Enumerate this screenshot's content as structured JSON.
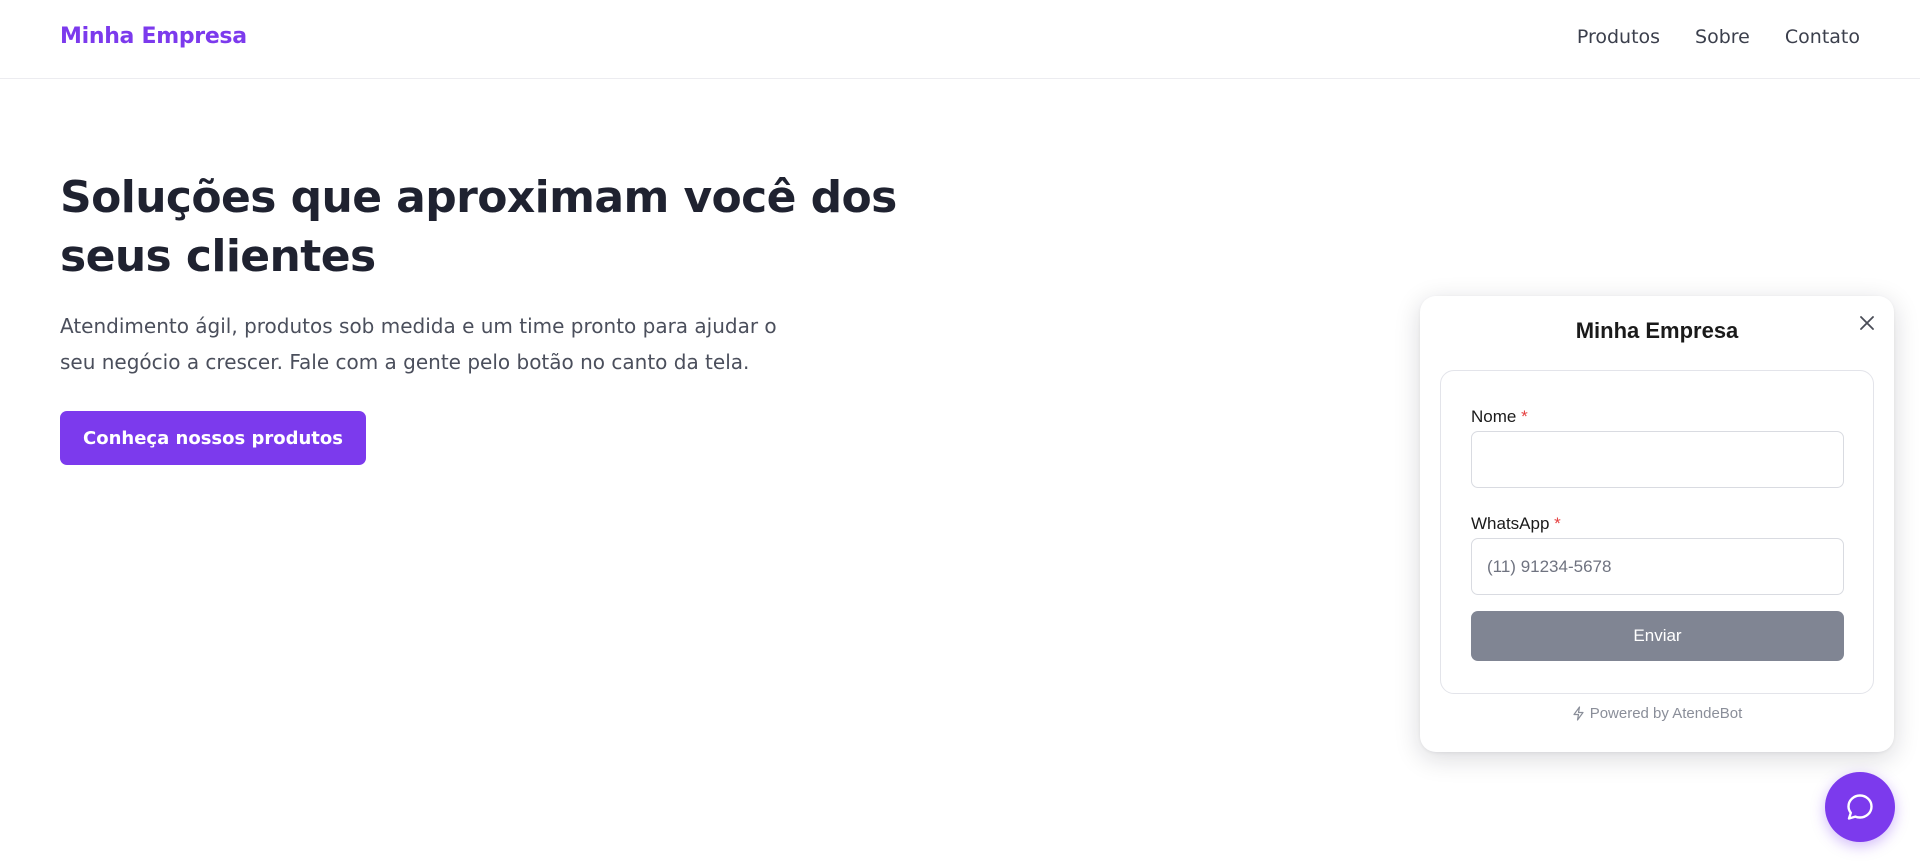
{
  "header": {
    "brand": "Minha Empresa",
    "nav": [
      "Produtos",
      "Sobre",
      "Contato"
    ]
  },
  "hero": {
    "title": "Soluções que aproximam você dos seus clientes",
    "subtitle": "Atendimento ágil, produtos sob medida e um time pronto para ajudar o seu negócio a crescer. Fale com a gente pelo botão no canto da tela.",
    "cta_label": "Conheça nossos produtos"
  },
  "widget": {
    "title": "Minha Empresa",
    "close_icon": "close-icon",
    "fields": {
      "name_label": "Nome",
      "name_value": "",
      "whatsapp_label": "WhatsApp",
      "whatsapp_placeholder": "(11) 91234-5678",
      "required_marker": "*"
    },
    "submit_label": "Enviar",
    "powered_icon": "lightning-icon",
    "powered_by": "Powered by AtendeBot"
  },
  "chat_button": {
    "icon": "chat-bubble-icon"
  },
  "colors": {
    "accent": "#7c3aed",
    "text_dark": "#1f2230",
    "text_muted": "#4b4f5c",
    "required": "#e53e3e",
    "submit_disabled": "#808593"
  }
}
